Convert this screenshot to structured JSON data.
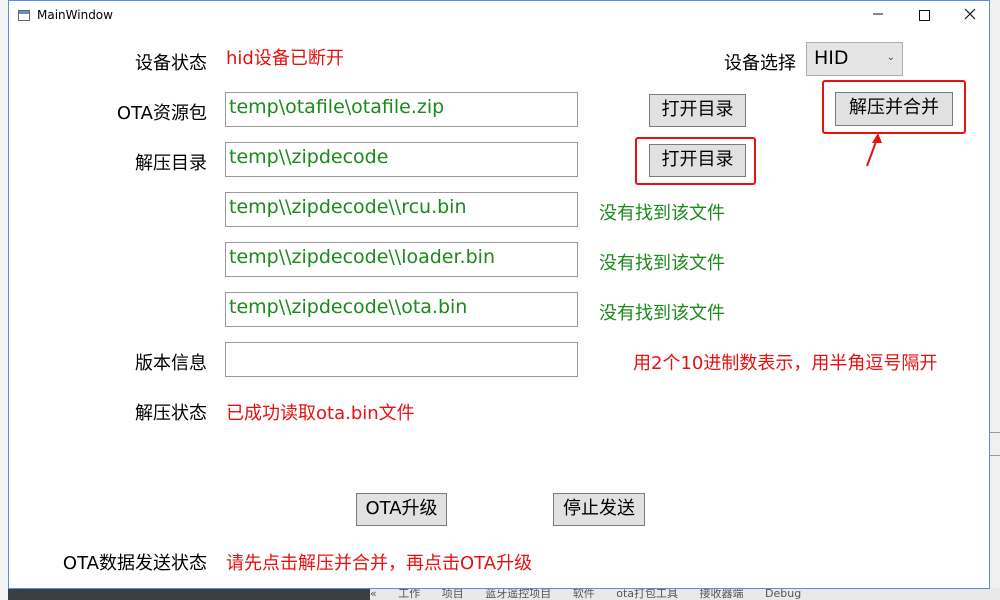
{
  "window": {
    "title": "MainWindow"
  },
  "labels": {
    "device_status": "设备状态",
    "device_select": "设备选择",
    "ota_package": "OTA资源包",
    "unzip_dir": "解压目录",
    "version_info": "版本信息",
    "unzip_status": "解压状态",
    "ota_send_status": "OTA数据发送状态"
  },
  "device_status_value": "hid设备已断开",
  "device_select": {
    "selected": "HID"
  },
  "fields": {
    "ota_package": "temp\\otafile\\otafile.zip",
    "unzip_dir": "temp\\\\zipdecode",
    "rcu_bin": "temp\\\\zipdecode\\\\rcu.bin",
    "loader_bin": "temp\\\\zipdecode\\\\loader.bin",
    "ota_bin": "temp\\\\zipdecode\\\\ota.bin",
    "version_info": ""
  },
  "file_status": {
    "rcu": "没有找到该文件",
    "loader": "没有找到该文件",
    "ota": "没有找到该文件"
  },
  "version_hint": "用2个10进制数表示，用半角逗号隔开",
  "unzip_status_value": "已成功读取ota.bin文件",
  "ota_send_status_value": "请先点击解压并合并，再点击OTA升级",
  "buttons": {
    "open_dir_1": "打开目录",
    "open_dir_2": "打开目录",
    "unzip_merge": "解压并合并",
    "ota_upgrade": "OTA升级",
    "stop_send": "停止发送"
  },
  "background": {
    "breadcrumb": [
      "«",
      "工作",
      "项目",
      "蓝牙遥控项目",
      "软件",
      "ota打包工具",
      "接收器端",
      "Debug"
    ]
  },
  "colors": {
    "error_red": "#e81010",
    "path_green": "#1a8a1a",
    "highlight_red": "#e81010"
  }
}
